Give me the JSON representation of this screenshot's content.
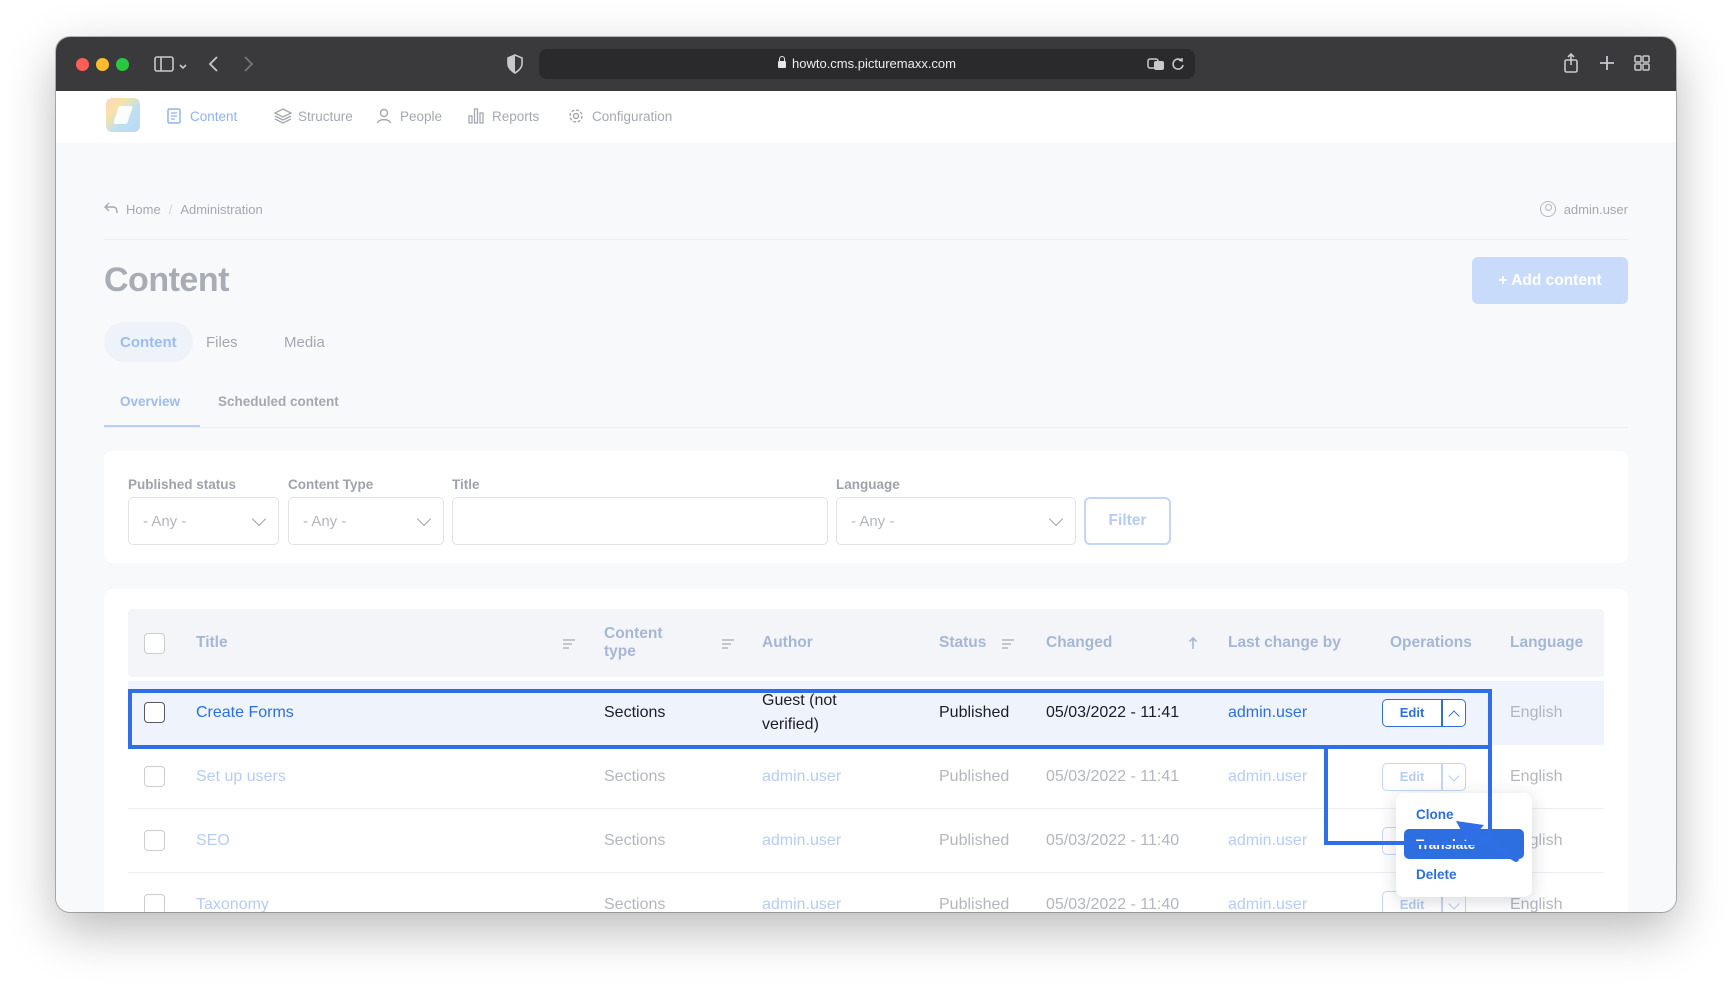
{
  "browser": {
    "url": "howto.cms.picturemaxx.com"
  },
  "nav": {
    "items": [
      {
        "label": "Content",
        "icon": "document-icon"
      },
      {
        "label": "Structure",
        "icon": "layers-icon"
      },
      {
        "label": "People",
        "icon": "person-icon"
      },
      {
        "label": "Reports",
        "icon": "bar-chart-icon"
      },
      {
        "label": "Configuration",
        "icon": "gear-icon"
      }
    ]
  },
  "breadcrumb": {
    "home": "Home",
    "separator": "/",
    "current": "Administration"
  },
  "user": {
    "name": "admin.user"
  },
  "page": {
    "title": "Content",
    "add_button": "+ Add content"
  },
  "tabs": [
    "Content",
    "Files",
    "Media"
  ],
  "subtabs": [
    "Overview",
    "Scheduled content"
  ],
  "filters": {
    "published_status": {
      "label": "Published status",
      "value": "- Any -"
    },
    "content_type": {
      "label": "Content Type",
      "value": "- Any -"
    },
    "title": {
      "label": "Title",
      "value": ""
    },
    "language": {
      "label": "Language",
      "value": "- Any -"
    },
    "button": "Filter"
  },
  "table": {
    "headers": {
      "title": "Title",
      "content_type": "Content type",
      "author": "Author",
      "status": "Status",
      "changed": "Changed",
      "last_change_by": "Last change by",
      "operations": "Operations",
      "language": "Language"
    },
    "rows": [
      {
        "title": "Create Forms",
        "content_type": "Sections",
        "author": "Guest (not verified)",
        "status": "Published",
        "changed": "05/03/2022 - 11:41",
        "last_change_by": "admin.user",
        "op": "Edit",
        "language": "English"
      },
      {
        "title": "Set up users",
        "content_type": "Sections",
        "author": "admin.user",
        "status": "Published",
        "changed": "05/03/2022 - 11:41",
        "last_change_by": "admin.user",
        "op": "Edit",
        "language": "English"
      },
      {
        "title": "SEO",
        "content_type": "Sections",
        "author": "admin.user",
        "status": "Published",
        "changed": "05/03/2022 - 11:40",
        "last_change_by": "admin.user",
        "op": "Edit",
        "language": "English"
      },
      {
        "title": "Taxonomy",
        "content_type": "Sections",
        "author": "admin.user",
        "status": "Published",
        "changed": "05/03/2022 - 11:40",
        "last_change_by": "admin.user",
        "op": "Edit",
        "language": "English"
      }
    ]
  },
  "dropdown": {
    "items": [
      "Clone",
      "Translate",
      "Delete"
    ],
    "highlighted": "Translate"
  },
  "colors": {
    "accent": "#2d6fe0",
    "highlight_box": "#2f6ee6"
  }
}
